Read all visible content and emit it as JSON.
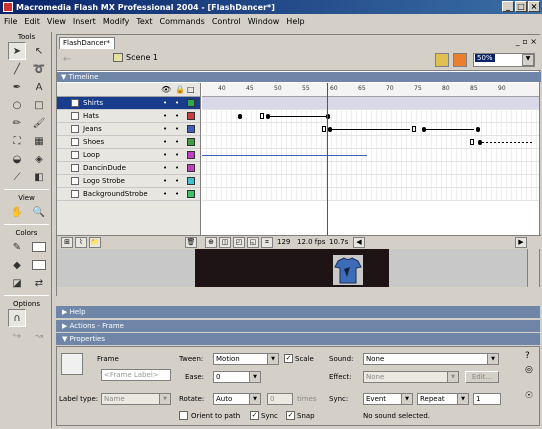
{
  "window": {
    "title": "Macromedia Flash MX Professional 2004 - [FlashDancer*]",
    "btn_min": "_",
    "btn_max": "□",
    "btn_close": "×"
  },
  "menu": [
    "File",
    "Edit",
    "View",
    "Insert",
    "Modify",
    "Text",
    "Commands",
    "Control",
    "Window",
    "Help"
  ],
  "tools_panel": {
    "title": "Tools",
    "view_title": "View",
    "colors_title": "Colors",
    "options_title": "Options"
  },
  "document": {
    "tab": "FlashDancer*",
    "tab_controls": "_ ▫ ×",
    "scene": "Scene 1",
    "zoom": "50%",
    "timeline_label": "Timeline"
  },
  "layers": [
    {
      "name": "Shirts",
      "color": "#2fa84f",
      "selected": true
    },
    {
      "name": "Hats",
      "color": "#c84040",
      "selected": false
    },
    {
      "name": "Jeans",
      "color": "#4060c0",
      "selected": false
    },
    {
      "name": "Shoes",
      "color": "#40a040",
      "selected": false
    },
    {
      "name": "Loop",
      "color": "#c040c0",
      "selected": false
    },
    {
      "name": "DancinDude",
      "color": "#c040c0",
      "selected": false
    },
    {
      "name": "Logo Strobe",
      "color": "#40c0d0",
      "selected": false
    },
    {
      "name": "BackgroundStrobe",
      "color": "#40c060",
      "selected": false
    }
  ],
  "ruler_ticks": [
    "40",
    "45",
    "50",
    "55",
    "60",
    "65",
    "70",
    "75",
    "80",
    "85",
    "90"
  ],
  "timeline_status": {
    "frame": "129",
    "fps": "12.0 fps",
    "time": "10.7s"
  },
  "panels": {
    "help": "Help",
    "actions": "Actions - Frame",
    "properties": "Properties"
  },
  "properties": {
    "frame_label": "Frame",
    "frame_placeholder": "<Frame Label>",
    "label_type_label": "Label type:",
    "label_type_value": "Name",
    "tween_label": "Tween:",
    "tween_value": "Motion",
    "scale_label": "Scale",
    "ease_label": "Ease:",
    "ease_value": "0",
    "rotate_label": "Rotate:",
    "rotate_value": "Auto",
    "times_value": "0",
    "times_label": "times",
    "orient_label": "Orient to path",
    "sync_cb_label": "Sync",
    "snap_label": "Snap",
    "sound_label": "Sound:",
    "sound_value": "None",
    "effect_label": "Effect:",
    "effect_value": "None",
    "edit_button": "Edit...",
    "sync_label": "Sync:",
    "sync_value": "Event",
    "repeat_value": "Repeat",
    "repeat_count": "1",
    "no_sound": "No sound selected."
  }
}
